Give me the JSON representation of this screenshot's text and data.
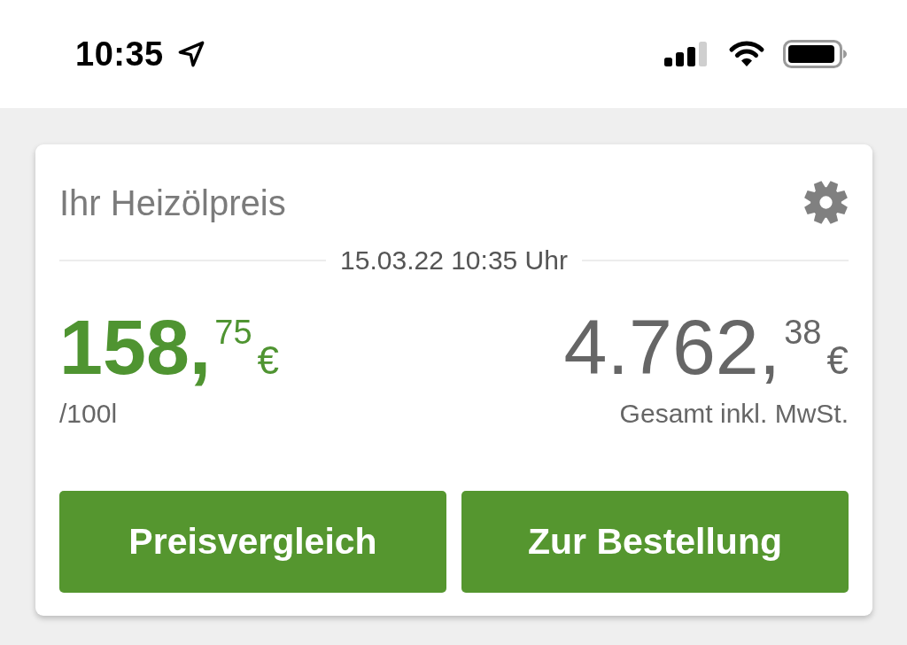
{
  "status_bar": {
    "time": "10:35"
  },
  "price_card": {
    "title": "Ihr Heizölpreis",
    "timestamp": "15.03.22 10:35 Uhr",
    "unit_price": {
      "main": "158,",
      "cents": "75",
      "currency": "€",
      "unit": "/100l"
    },
    "total_price": {
      "main": "4.762,",
      "cents": "38",
      "currency": "€",
      "note": "Gesamt inkl. MwSt."
    },
    "buttons": [
      "Preisvergleich",
      "Zur Bestellung"
    ]
  }
}
